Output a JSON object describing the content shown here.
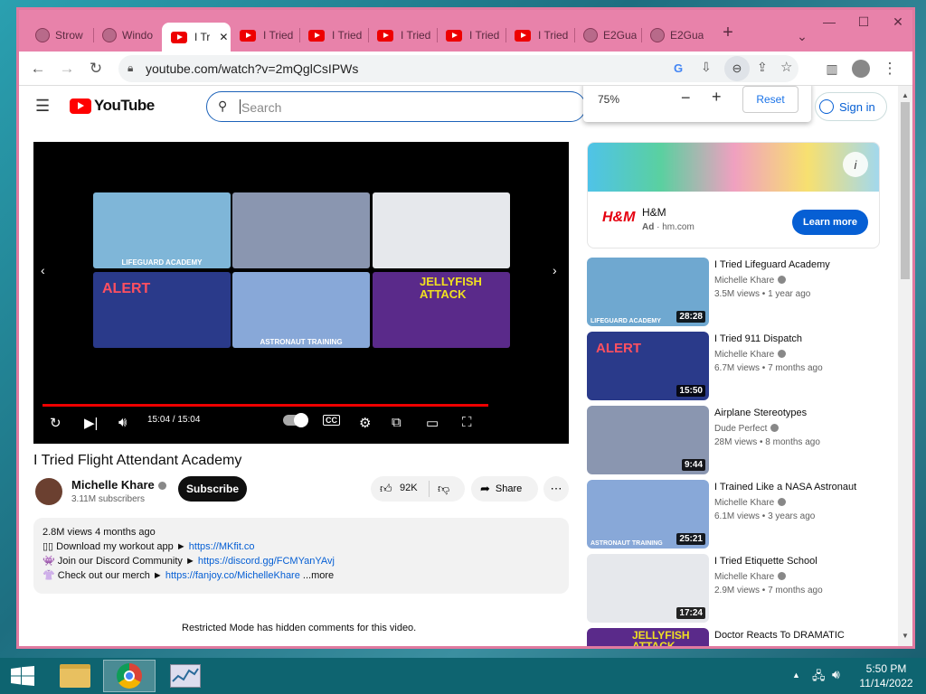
{
  "tabs": [
    {
      "title": "Strow",
      "type": "globe"
    },
    {
      "title": "Windo",
      "type": "globe"
    },
    {
      "title": "I Tr",
      "type": "yt",
      "active": true
    },
    {
      "title": "I Tried",
      "type": "yt"
    },
    {
      "title": "I Tried",
      "type": "yt"
    },
    {
      "title": "I Tried",
      "type": "yt"
    },
    {
      "title": "I Tried",
      "type": "yt"
    },
    {
      "title": "I Tried",
      "type": "yt"
    },
    {
      "title": "E2Gua",
      "type": "globe"
    },
    {
      "title": "E2Gua",
      "type": "globe"
    }
  ],
  "omnibox": {
    "url": "youtube.com/watch?v=2mQglCsIPWs"
  },
  "zoom": {
    "level": "75%",
    "minus": "−",
    "plus": "+",
    "reset": "Reset"
  },
  "yt": {
    "logo": "YouTube",
    "search_placeholder": "Search",
    "sign_in": "Sign in"
  },
  "player": {
    "time": "15:04 / 15:04",
    "grid": [
      {
        "caption": "LIFEGUARD ACADEMY",
        "color": "#7fb6d8"
      },
      {
        "caption": "",
        "color": "#8a96b0"
      },
      {
        "caption": "",
        "color": "#e6e8ec"
      },
      {
        "caption": "ALERT",
        "color": "#2a3a8a"
      },
      {
        "caption": "ASTRONAUT TRAINING",
        "color": "#88a8d8"
      },
      {
        "caption": "JELLYFISH ATTACK",
        "color": "#5a2a8a"
      }
    ]
  },
  "video": {
    "title": "I Tried Flight Attendant Academy",
    "channel": "Michelle Khare",
    "subscribers": "3.11M subscribers",
    "subscribe": "Subscribe",
    "likes": "92K",
    "share": "Share"
  },
  "description": {
    "meta": "2.8M views  4 months ago",
    "line1_text": "▯▯ Download my workout app ► ",
    "line1_link": "https://MKfit.co",
    "line2_text": "👾 Join our Discord Community ► ",
    "line2_link": "https://discord.gg/FCMYanYAvj",
    "line3_text": "👚 Check out our merch ► ",
    "line3_link": "https://fanjoy.co/MichelleKhare",
    "more": " ...more"
  },
  "restricted": "Restricted Mode has hidden comments for this video.",
  "ad": {
    "brand": "H&M",
    "logo": "H&M",
    "ad_label": "Ad",
    "domain": "hm.com",
    "cta": "Learn more"
  },
  "recommendations": [
    {
      "title": "I Tried Lifeguard Academy",
      "channel": "Michelle Khare",
      "meta": "3.5M views • 1 year ago",
      "duration": "28:28",
      "color": "#6fa8d0",
      "caption": "LIFEGUARD ACADEMY"
    },
    {
      "title": "I Tried 911 Dispatch",
      "channel": "Michelle Khare",
      "meta": "6.7M views • 7 months ago",
      "duration": "15:50",
      "color": "#2a3a8a",
      "caption": "ALERT"
    },
    {
      "title": "Airplane Stereotypes",
      "channel": "Dude Perfect",
      "meta": "28M views • 8 months ago",
      "duration": "9:44",
      "color": "#8a96b0",
      "caption": ""
    },
    {
      "title": "I Trained Like a NASA Astronaut",
      "channel": "Michelle Khare",
      "meta": "6.1M views • 3 years ago",
      "duration": "25:21",
      "color": "#88a8d8",
      "caption": "ASTRONAUT TRAINING"
    },
    {
      "title": "I Tried Etiquette School",
      "channel": "Michelle Khare",
      "meta": "2.9M views • 7 months ago",
      "duration": "17:24",
      "color": "#e6e8ec",
      "caption": ""
    },
    {
      "title": "Doctor Reacts To DRAMATIC",
      "channel": "",
      "meta": "",
      "duration": "",
      "color": "#5a2a8a",
      "caption": "JELLYFISH ATTACK"
    }
  ],
  "clock": {
    "time": "5:50 PM",
    "date": "11/14/2022"
  },
  "colors": {
    "accent": "#065fd4",
    "red": "#ff0000",
    "tabbar": "#e882aa"
  }
}
